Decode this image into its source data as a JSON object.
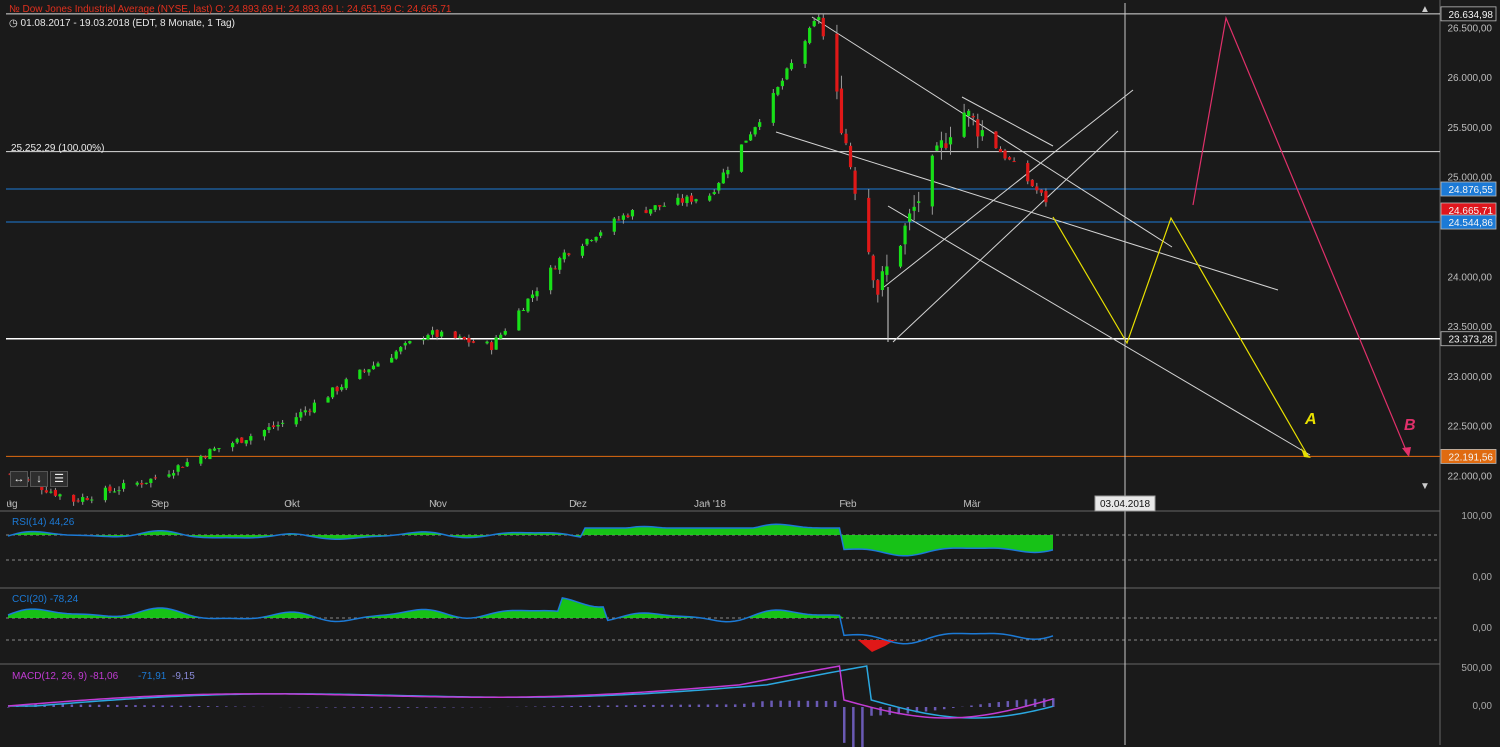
{
  "header": {
    "instrument_line": "Dow Jones Industrial Average (NYSE, last)  O: 24.893,69  H: 24.893,69  L: 24.651,59  C: 24.665,71",
    "range_line": "01.08.2017 - 19.03.2018   (EDT, 8 Monate, 1 Tag)"
  },
  "price_axis": {
    "ticks": [
      "26.500,00",
      "26.000,00",
      "25.500,00",
      "25.000,00",
      "24.000,00",
      "23.500,00",
      "23.000,00",
      "22.500,00",
      "22.000,00"
    ],
    "badges": [
      {
        "value": "26.634,98",
        "color": "#1a1a1a"
      },
      {
        "value": "24.876,55",
        "color": "#1c7ad6"
      },
      {
        "value": "24.665,71",
        "color": "#e0161d"
      },
      {
        "value": "24.544,86",
        "color": "#1c7ad6"
      },
      {
        "value": "23.373,28",
        "color": "#1a1a1a"
      },
      {
        "value": "22.191,56",
        "color": "#e06b10"
      }
    ]
  },
  "x_axis": {
    "months": [
      "ug",
      "Sep",
      "Okt",
      "Nov",
      "Dez",
      "Jan '18",
      "Feb",
      "Mär"
    ]
  },
  "annotations": {
    "fib_label": "25.252,29 (100.00%)",
    "cursor_date": "03.04.2018",
    "wave_a": "A",
    "wave_b": "B"
  },
  "indicators": {
    "rsi": {
      "label": "RSI(14)",
      "value": "44,26",
      "ticks": [
        "100,00",
        "0,00"
      ]
    },
    "cci": {
      "label": "CCI(20)",
      "value": "-78,24",
      "ticks": [
        "0,00"
      ]
    },
    "macd": {
      "label": "MACD(12, 26, 9)",
      "v1": "-81,06",
      "v2": "-71,91",
      "v3": "-9,15",
      "ticks": [
        "500,00",
        "0,00"
      ]
    }
  },
  "toolbar": {
    "icons": [
      "expand-horizontal-icon",
      "download-icon",
      "menu-icon"
    ]
  },
  "colors": {
    "up": "#18e018",
    "down": "#e01818",
    "blue": "#1c7ad6",
    "orange": "#e06b10",
    "yellow": "#e8e000",
    "pink": "#e0306a",
    "grid": "#ffffff"
  },
  "chart_data": {
    "type": "candlestick",
    "title": "Dow Jones Industrial Average (NYSE, last)",
    "x_range": [
      "01.08.2017",
      "19.03.2018"
    ],
    "ylim": [
      21700,
      26800
    ],
    "x": [
      "2017-08-01",
      "2017-08-15",
      "2017-09-01",
      "2017-09-15",
      "2017-10-02",
      "2017-10-16",
      "2017-11-01",
      "2017-11-15",
      "2017-12-01",
      "2017-12-15",
      "2018-01-02",
      "2018-01-16",
      "2018-01-26",
      "2018-02-08",
      "2018-02-26",
      "2018-03-19"
    ],
    "close": [
      22016,
      21750,
      21960,
      22260,
      22560,
      23000,
      23430,
      23300,
      24230,
      24630,
      24820,
      25800,
      26616,
      23860,
      25700,
      24665
    ],
    "horizontal_levels": [
      26634.98,
      25252.29,
      24876.55,
      24544.86,
      23373.28,
      22191.56
    ]
  }
}
